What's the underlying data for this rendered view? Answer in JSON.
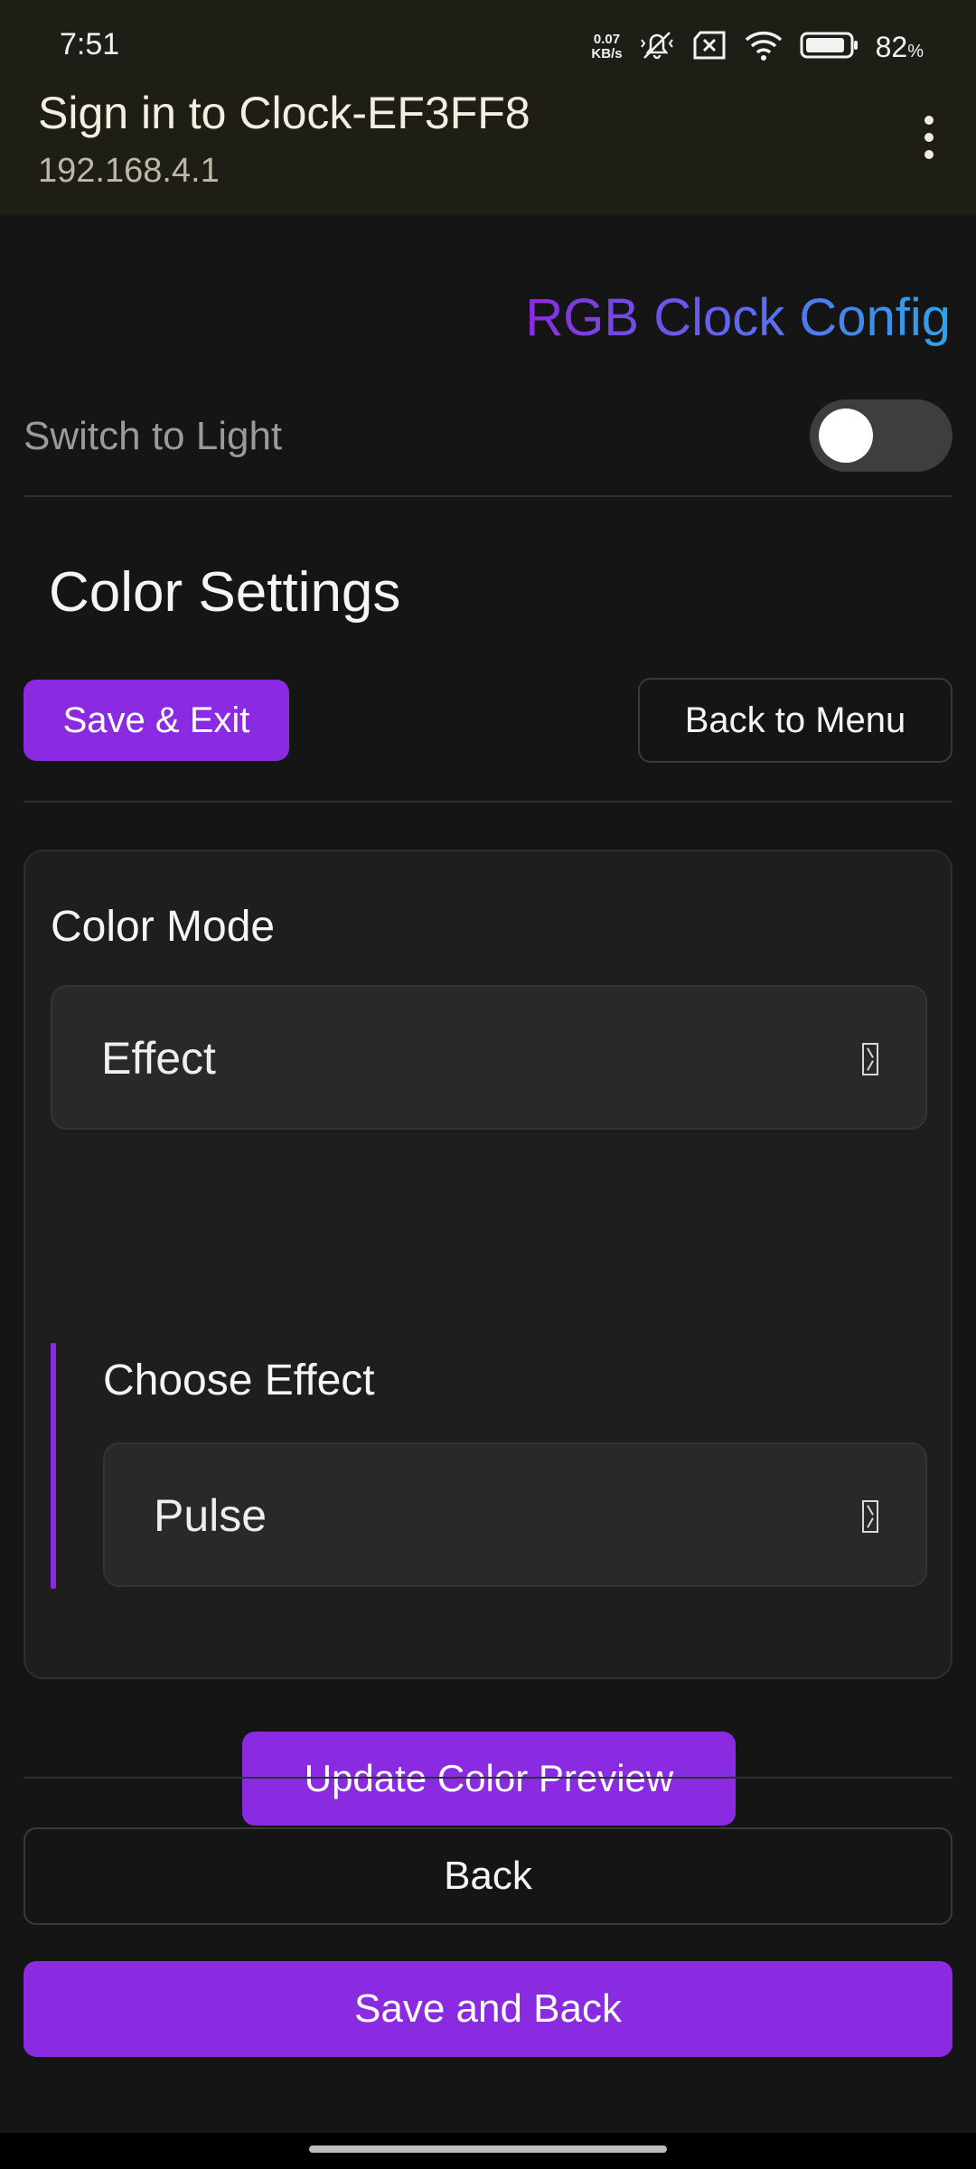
{
  "status_bar": {
    "time": "7:51",
    "net_speed_value": "0.07",
    "net_speed_unit": "KB/s",
    "battery_percent": "82",
    "battery_symbol": "%",
    "icons": [
      "mute-vibrate-icon",
      "no-sim-icon",
      "wifi-icon",
      "battery-icon"
    ]
  },
  "portal_header": {
    "title": "Sign in to Clock-EF3FF8",
    "subtitle": "192.168.4.1"
  },
  "page": {
    "brand": "RGB Clock Config",
    "theme_toggle": {
      "label": "Switch to Light",
      "on": false
    },
    "section_title": "Color Settings",
    "save_exit_label": "Save & Exit",
    "back_to_menu_label": "Back to Menu",
    "color_mode": {
      "label": "Color Mode",
      "value": "Effect"
    },
    "effect": {
      "label": "Choose Effect",
      "value": "Pulse"
    },
    "update_preview_label": "Update Color Preview",
    "back_label": "Back",
    "save_and_back_label": "Save and Back"
  },
  "colors": {
    "accent": "#8a2be2",
    "brand_gradient_start": "#8a2be2",
    "brand_gradient_end": "#2aa5ea",
    "background": "#151515",
    "card": "#1e1e1e"
  }
}
